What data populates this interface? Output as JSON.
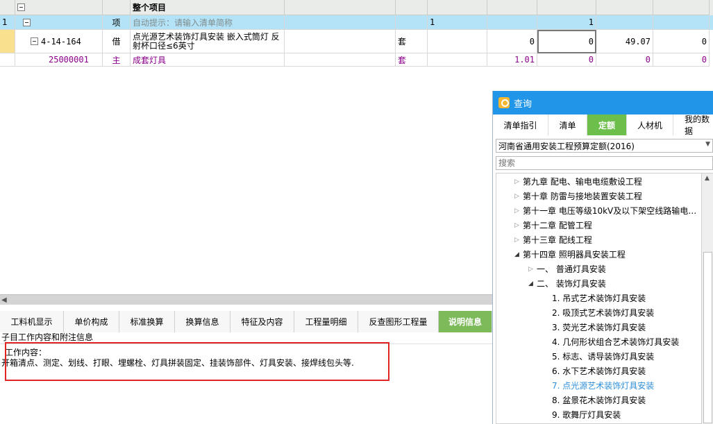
{
  "grid": {
    "header": {
      "name_col": "整个项目"
    },
    "row1": {
      "no": "1",
      "type": "项",
      "name_hint": "自动提示：请输入清单简称",
      "qty_left": "1",
      "qty_right": "1"
    },
    "row2": {
      "code": "4-14-164",
      "type": "借",
      "name": "点光源艺术装饰灯具安装 嵌入式筒灯 反射杯口径≤6英寸",
      "unit": "套",
      "c1": "0",
      "c2": "0",
      "c3": "49.07",
      "c4": "0"
    },
    "row3": {
      "code": "25000001",
      "type": "主",
      "name": "成套灯具",
      "unit": "套",
      "c1": "1.01",
      "c2": "0",
      "c3": "0",
      "c4": "0"
    }
  },
  "tabs": [
    {
      "label": "工料机显示"
    },
    {
      "label": "单价构成"
    },
    {
      "label": "标准换算"
    },
    {
      "label": "换算信息"
    },
    {
      "label": "特征及内容"
    },
    {
      "label": "工程量明细"
    },
    {
      "label": "反查图形工程量"
    },
    {
      "label": "说明信息"
    }
  ],
  "subhead": "子目工作内容和附注信息",
  "content": {
    "line1": "工作内容：",
    "line2": "开箱清点、测定、划线、打眼、埋螺栓、灯具拼装固定、挂装饰部件、灯具安装、接焊线包头等."
  },
  "panel": {
    "title": "查询",
    "tabs": [
      "清单指引",
      "清单",
      "定额",
      "人材机",
      "我的数据"
    ],
    "select_value": "河南省通用安装工程预算定额(2016)",
    "search_placeholder": "搜索",
    "tree": [
      {
        "label": "第九章 配电、输电电缆敷设工程"
      },
      {
        "label": "第十章 防雷与接地装置安装工程"
      },
      {
        "label": "第十一章 电压等级10kV及以下架空线路输电…"
      },
      {
        "label": "第十二章 配管工程"
      },
      {
        "label": "第十三章 配线工程"
      },
      {
        "label": "第十四章 照明器具安装工程"
      },
      {
        "label": "一、 普通灯具安装"
      },
      {
        "label": "二、 装饰灯具安装"
      },
      {
        "label": "1. 吊式艺术装饰灯具安装"
      },
      {
        "label": "2. 吸顶式艺术装饰灯具安装"
      },
      {
        "label": "3. 荧光艺术装饰灯具安装"
      },
      {
        "label": "4. 几何形状组合艺术装饰灯具安装"
      },
      {
        "label": "5. 标志、诱导装饰灯具安装"
      },
      {
        "label": "6. 水下艺术装饰灯具安装"
      },
      {
        "label": "7. 点光源艺术装饰灯具安装"
      },
      {
        "label": "8. 盆景花木装饰灯具安装"
      },
      {
        "label": "9. 歌舞厅灯具安装"
      }
    ]
  },
  "colors": {
    "selected_row": "#b4e3f7",
    "active_tab": "#7dbb5a",
    "panel_title": "#2196e8",
    "highlight_box": "#e02424",
    "purple_text": "#8b008b"
  }
}
